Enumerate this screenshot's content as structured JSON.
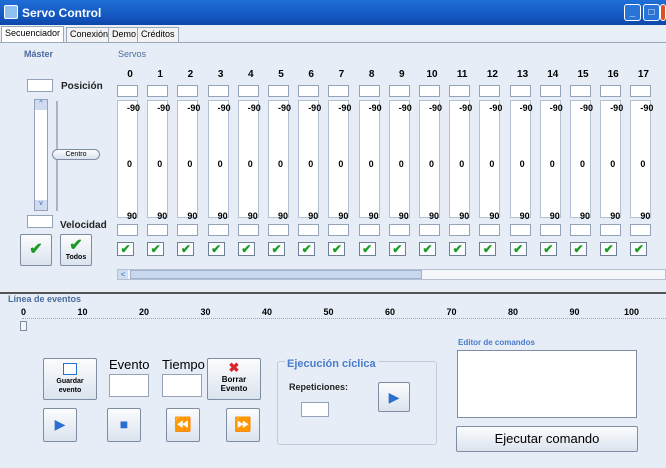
{
  "window": {
    "title": "Servo Control",
    "controls": [
      "_",
      "□",
      "x"
    ]
  },
  "tabs": [
    "Secuenciador",
    "Conexión",
    "Demo",
    "Créditos"
  ],
  "master": {
    "group_label": "Máster",
    "position_label": "Posición",
    "center_button": "Centro",
    "speed_label": "Velocidad",
    "all_button": "Todos"
  },
  "servos": {
    "group_label": "Servos",
    "top_value": "-90",
    "mid_value": "0",
    "bottom_value": "90",
    "ids": [
      "0",
      "1",
      "2",
      "3",
      "4",
      "5",
      "6",
      "7",
      "8",
      "9",
      "10",
      "11",
      "12",
      "13",
      "14",
      "15",
      "16",
      "17"
    ]
  },
  "events": {
    "group_label": "Línea de eventos",
    "ticks": [
      "0",
      "10",
      "20",
      "30",
      "40",
      "50",
      "60",
      "70",
      "80",
      "90",
      "100"
    ],
    "save_button": "Guardar evento",
    "event_label": "Evento",
    "time_label": "Tiempo",
    "delete_button": "Borrar Evento"
  },
  "cyclic": {
    "group_label": "Ejecución cíclica",
    "repetitions_label": "Repeticiones:"
  },
  "commands": {
    "editor_label": "Editor de comandos",
    "execute_button": "Ejecutar comando"
  },
  "colors": {
    "titlebar": "#1558c2",
    "check": "#1b9a24",
    "accent": "#2a6fd0"
  }
}
